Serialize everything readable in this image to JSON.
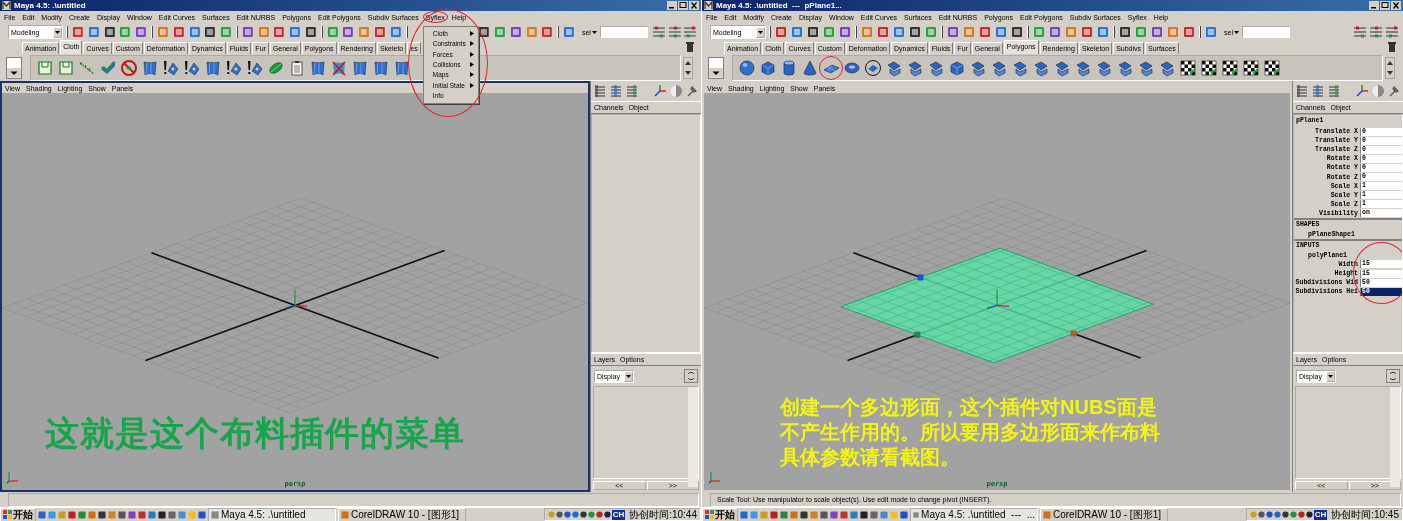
{
  "windows": [
    {
      "title": "Maya 4.5: .\\untitled",
      "menus": [
        {
          "label": "File",
          "circled": false
        },
        {
          "label": "Edit",
          "circled": false
        },
        {
          "label": "Modify",
          "circled": false
        },
        {
          "label": "Create",
          "circled": false
        },
        {
          "label": "Display",
          "circled": false
        },
        {
          "label": "Window",
          "circled": false
        },
        {
          "label": "Edit Curves",
          "circled": false
        },
        {
          "label": "Surfaces",
          "circled": false
        },
        {
          "label": "Edit NURBS",
          "circled": false
        },
        {
          "label": "Polygons",
          "circled": false
        },
        {
          "label": "Edit Polygons",
          "circled": false
        },
        {
          "label": "Subdiv Surfaces",
          "circled": false
        },
        {
          "label": "Syflex",
          "circled": true,
          "dropdown": {
            "circled": true,
            "items": [
              {
                "label": "Cloth",
                "submenu": true
              },
              {
                "label": "Constraints",
                "submenu": true
              },
              {
                "label": "Forces",
                "submenu": true
              },
              {
                "label": "Collisions",
                "submenu": true
              },
              {
                "label": "Maps",
                "submenu": true
              },
              {
                "label": "Initial State",
                "submenu": true
              },
              {
                "label": "Info",
                "submenu": false
              }
            ]
          }
        },
        {
          "label": "Help",
          "circled": false
        }
      ],
      "mode": "Modeling",
      "sel_label": "sel",
      "shelf_tabs": [
        {
          "label": "Animation",
          "selected": false
        },
        {
          "label": "Cloth",
          "selected": true
        },
        {
          "label": "Curves",
          "selected": false
        },
        {
          "label": "Custom",
          "selected": false
        },
        {
          "label": "Deformation",
          "selected": false
        },
        {
          "label": "Dynamics",
          "selected": false
        },
        {
          "label": "Fluids",
          "selected": false
        },
        {
          "label": "Fur",
          "selected": false
        },
        {
          "label": "General",
          "selected": false
        },
        {
          "label": "Polygons",
          "selected": false
        },
        {
          "label": "Rendering",
          "selected": false
        },
        {
          "label": "Skeleto",
          "selected": false
        },
        {
          "label": "es",
          "selected": false
        }
      ],
      "shelf_tools": [
        {
          "kind": "frame",
          "circled": false
        },
        {
          "kind": "frame",
          "circled": false
        },
        {
          "kind": "stitch",
          "circled": false
        },
        {
          "kind": "check",
          "circled": false
        },
        {
          "kind": "forbid",
          "circled": false
        },
        {
          "kind": "fabric",
          "circled": false
        },
        {
          "kind": "alert",
          "circled": false
        },
        {
          "kind": "alert",
          "circled": false
        },
        {
          "kind": "fabric",
          "circled": false
        },
        {
          "kind": "alert",
          "circled": false
        },
        {
          "kind": "alert",
          "circled": false
        },
        {
          "kind": "leaf",
          "circled": false
        },
        {
          "kind": "clip",
          "circled": false
        },
        {
          "kind": "fabric",
          "circled": false
        },
        {
          "kind": "cross",
          "circled": false
        },
        {
          "kind": "fabric",
          "circled": false
        },
        {
          "kind": "fabric",
          "circled": false
        },
        {
          "kind": "fabric",
          "circled": false
        }
      ],
      "panel_menus": [
        "View",
        "Shading",
        "Lighting",
        "Show",
        "Panels"
      ],
      "viewport": {
        "active": true,
        "plane": false,
        "camera": "persp",
        "caption": {
          "kind": "banner",
          "text": "这就是这个布料插件的菜单",
          "color": "#16a54a"
        }
      },
      "side": {
        "channel_tabs": [
          "Channels",
          "Object"
        ],
        "layer_tabs": [
          "Layers",
          "Options"
        ],
        "layer_display": "Display",
        "scroll_buttons": [
          "<<",
          ">>"
        ]
      },
      "taskbar": {
        "start": "开始",
        "tasks": [
          {
            "label": "Maya 4.5: .\\untitled",
            "selected": true
          },
          {
            "label": "CorelDRAW 10 - [图形1]",
            "selected": false
          }
        ],
        "ime": "CH",
        "clock": "协创时间:10:44"
      }
    },
    {
      "title": "Maya 4.5: .\\untitled  ---  pPlane1...",
      "menus": [
        {
          "label": "File",
          "circled": false
        },
        {
          "label": "Edit",
          "circled": false
        },
        {
          "label": "Modify",
          "circled": false
        },
        {
          "label": "Create",
          "circled": false
        },
        {
          "label": "Display",
          "circled": false
        },
        {
          "label": "Window",
          "circled": false
        },
        {
          "label": "Edit Curves",
          "circled": false
        },
        {
          "label": "Surfaces",
          "circled": false
        },
        {
          "label": "Edit NURBS",
          "circled": false
        },
        {
          "label": "Polygons",
          "circled": false
        },
        {
          "label": "Edit Polygons",
          "circled": false
        },
        {
          "label": "Subdiv Surfaces",
          "circled": false
        },
        {
          "label": "Syflex",
          "circled": false
        },
        {
          "label": "Help",
          "circled": false
        }
      ],
      "mode": "Modeling",
      "sel_label": "sel",
      "shelf_tabs": [
        {
          "label": "Animation",
          "selected": false
        },
        {
          "label": "Cloth",
          "selected": false
        },
        {
          "label": "Curves",
          "selected": false
        },
        {
          "label": "Custom",
          "selected": false
        },
        {
          "label": "Deformation",
          "selected": false
        },
        {
          "label": "Dynamics",
          "selected": false
        },
        {
          "label": "Fluids",
          "selected": false
        },
        {
          "label": "Fur",
          "selected": false
        },
        {
          "label": "General",
          "selected": false
        },
        {
          "label": "Polygons",
          "selected": true
        },
        {
          "label": "Rendering",
          "selected": false
        },
        {
          "label": "Skeleton",
          "selected": false
        },
        {
          "label": "Subdivs",
          "selected": false
        },
        {
          "label": "Surfaces",
          "selected": false
        }
      ],
      "shelf_tools": [
        {
          "kind": "sphere",
          "circled": false
        },
        {
          "kind": "cube",
          "circled": false
        },
        {
          "kind": "cylinder",
          "circled": false
        },
        {
          "kind": "cone",
          "circled": false
        },
        {
          "kind": "plane",
          "circled": true
        },
        {
          "kind": "torus",
          "circled": false
        },
        {
          "kind": "disk",
          "circled": false
        },
        {
          "kind": "poly",
          "circled": false
        },
        {
          "kind": "poly",
          "circled": false
        },
        {
          "kind": "poly",
          "circled": false
        },
        {
          "kind": "cube",
          "circled": false
        },
        {
          "kind": "poly",
          "circled": false
        },
        {
          "kind": "poly",
          "circled": false
        },
        {
          "kind": "poly",
          "circled": false
        },
        {
          "kind": "poly",
          "circled": false
        },
        {
          "kind": "poly",
          "circled": false
        },
        {
          "kind": "poly",
          "circled": false
        },
        {
          "kind": "poly",
          "circled": false
        },
        {
          "kind": "poly",
          "circled": false
        },
        {
          "kind": "poly",
          "circled": false
        },
        {
          "kind": "poly",
          "circled": false
        },
        {
          "kind": "checker",
          "circled": false
        },
        {
          "kind": "checker",
          "circled": false
        },
        {
          "kind": "checker",
          "circled": false
        },
        {
          "kind": "checker",
          "circled": false
        },
        {
          "kind": "checker",
          "circled": false
        }
      ],
      "panel_menus": [
        "View",
        "Shading",
        "Lighting",
        "Show",
        "Panels"
      ],
      "viewport": {
        "active": false,
        "plane": true,
        "camera": "persp",
        "caption": {
          "kind": "note",
          "text": "创建一个多边形面，这个插件对NUBS面是不产生作用的。所以要用多边形面来作布料具体参数请看截图。",
          "color": "#f4f414"
        }
      },
      "side": {
        "channel_tabs": [
          "Channels",
          "Object"
        ],
        "channel_box": {
          "node": "pPlane1",
          "attributes": [
            {
              "label": "Translate X",
              "value": "0",
              "selected": false
            },
            {
              "label": "Translate Y",
              "value": "0",
              "selected": false
            },
            {
              "label": "Translate Z",
              "value": "0",
              "selected": false
            },
            {
              "label": "Rotate X",
              "value": "0",
              "selected": false
            },
            {
              "label": "Rotate Y",
              "value": "0",
              "selected": false
            },
            {
              "label": "Rotate Z",
              "value": "0",
              "selected": false
            },
            {
              "label": "Scale X",
              "value": "1",
              "selected": false
            },
            {
              "label": "Scale Y",
              "value": "1",
              "selected": false
            },
            {
              "label": "Scale Z",
              "value": "1",
              "selected": false
            },
            {
              "label": "Visibility",
              "value": "on",
              "selected": false
            }
          ],
          "shapes_header": "SHAPES",
          "shape": "pPlaneShape1",
          "inputs_header": "INPUTS",
          "input_node": "polyPlane1",
          "inputs_circled": true,
          "input_attributes": [
            {
              "label": "Width",
              "value": "15",
              "selected": false
            },
            {
              "label": "Height",
              "value": "15",
              "selected": false
            },
            {
              "label": "Subdivisions Wid",
              "value": "50",
              "selected": false
            },
            {
              "label": "Subdivisions Hei",
              "value": "50",
              "selected": true
            }
          ]
        },
        "layer_tabs": [
          "Layers",
          "Options"
        ],
        "layer_display": "Display",
        "scroll_buttons": [
          "<<",
          ">>"
        ]
      },
      "help_line": "Scale Tool: Use manipulator to scale object(s). Use edit mode to change pivot (INSERT).",
      "taskbar": {
        "start": "开始",
        "tasks": [
          {
            "label": "Maya 4.5: .\\untitled  ---  ...",
            "selected": true
          },
          {
            "label": "CorelDRAW 10 - [图形1]",
            "selected": false
          }
        ],
        "ime": "CH",
        "clock": "协创时间:10:45"
      }
    }
  ]
}
